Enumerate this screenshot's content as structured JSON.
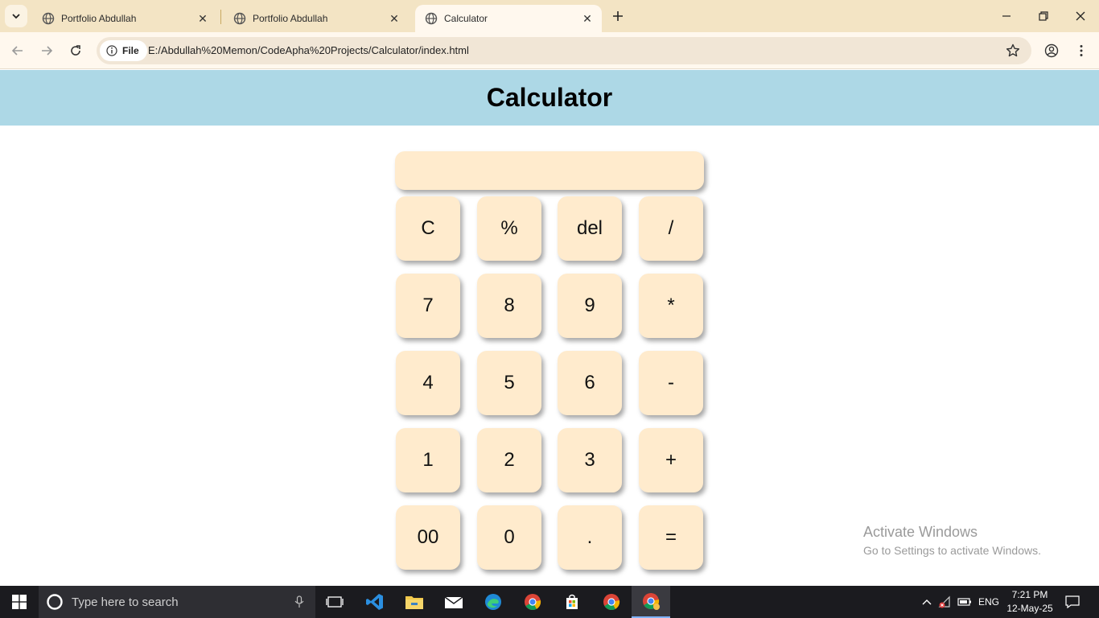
{
  "browser": {
    "tabs": [
      {
        "title": "Portfolio Abdullah"
      },
      {
        "title": "Portfolio Abdullah"
      },
      {
        "title": "Calculator"
      }
    ],
    "site_chip": "File",
    "url": "E:/Abdullah%20Memon/CodeApha%20Projects/Calculator/index.html"
  },
  "page": {
    "title": "Calculator",
    "display_value": ""
  },
  "keys": [
    "C",
    "%",
    "del",
    "/",
    "7",
    "8",
    "9",
    "*",
    "4",
    "5",
    "6",
    "-",
    "1",
    "2",
    "3",
    "+",
    "00",
    "0",
    ".",
    "="
  ],
  "watermark": {
    "line1": "Activate Windows",
    "line2": "Go to Settings to activate Windows."
  },
  "taskbar": {
    "search_placeholder": "Type here to search",
    "language": "ENG",
    "time": "7:21 PM",
    "date": "12-May-25"
  },
  "colors": {
    "header_bg": "#add8e6",
    "key_bg": "#ffebcd",
    "tabstrip_bg": "#f3e4c4"
  }
}
